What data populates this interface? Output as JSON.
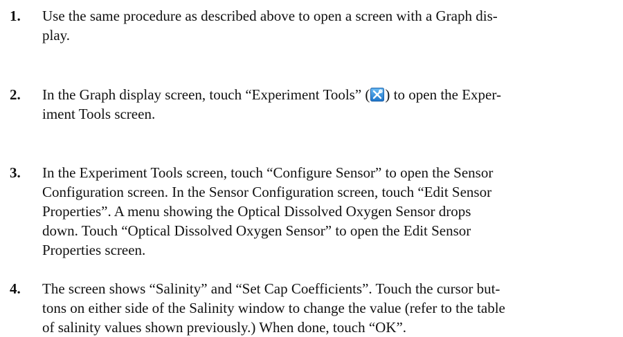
{
  "steps": [
    {
      "number": "1.",
      "lines": [
        "Use the same procedure as described above to open a screen with a Graph dis-",
        "play."
      ]
    },
    {
      "number": "2.",
      "line1_before_icon": "In the Graph display screen, touch “Experiment Tools” (",
      "icon": "experiment-tools-icon",
      "line1_after_icon": ") to open the Exper-",
      "line2": "iment Tools screen."
    },
    {
      "number": "3.",
      "lines": [
        "In the Experiment Tools screen, touch “Configure Sensor” to open the Sensor",
        "Configuration screen. In the Sensor Configuration screen, touch “Edit Sensor",
        "Properties”. A menu showing the Optical Dissolved Oxygen Sensor drops",
        "down. Touch “Optical Dissolved Oxygen Sensor” to open the Edit Sensor",
        "Properties screen."
      ]
    },
    {
      "number": "4.",
      "lines": [
        "The screen shows “Salinity” and “Set Cap Coefficients”. Touch the cursor but-",
        "tons on either side of the Salinity window to change the value (refer to the table",
        "of salinity values shown previously.) When done, touch “OK”."
      ]
    }
  ],
  "colors": {
    "text": "#111111",
    "icon_background": "#2f8fe0",
    "icon_foreground": "#ffffff"
  }
}
